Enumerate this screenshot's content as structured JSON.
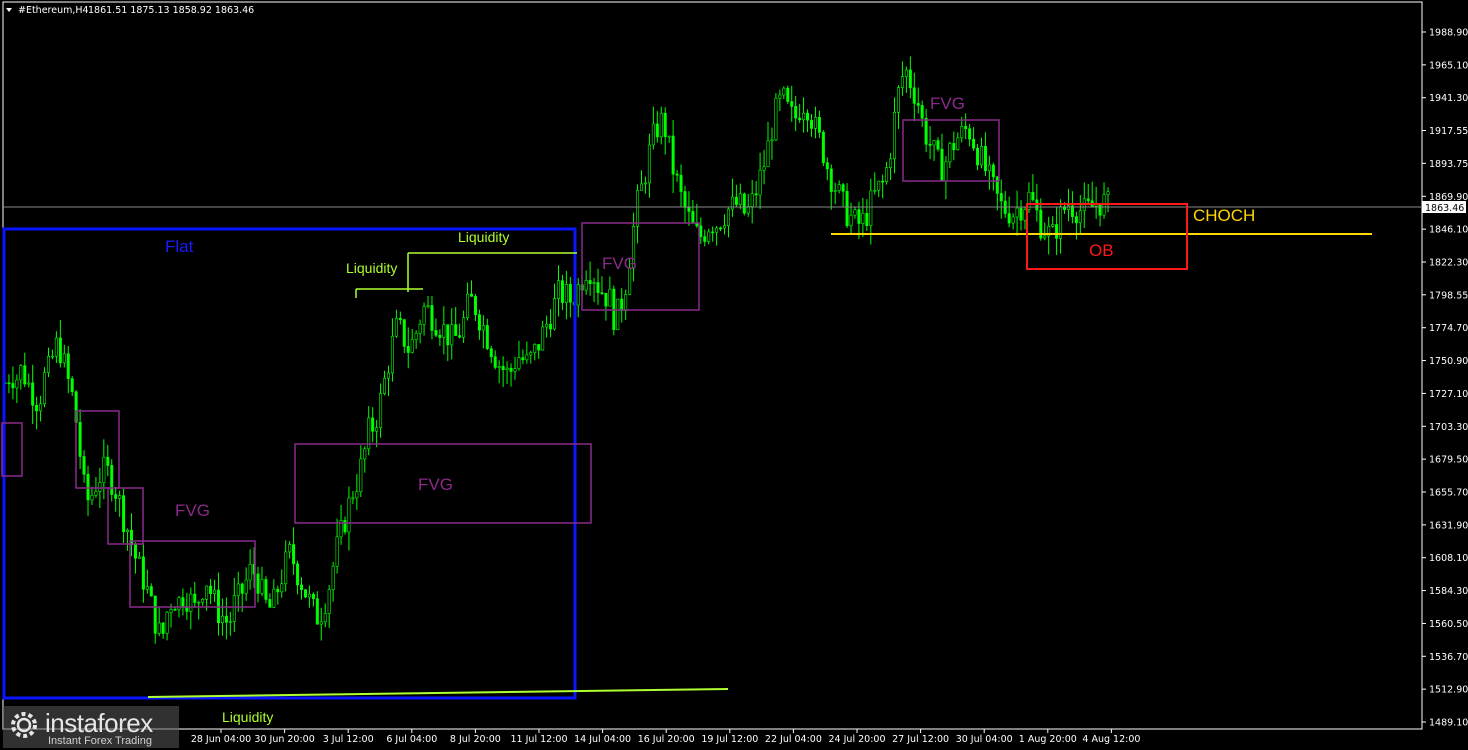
{
  "header": {
    "symbol": "#Ethereum,H4",
    "ohlc": "1861.51 1875.13 1858.92 1863.46"
  },
  "chart_data": {
    "type": "candlestick",
    "symbol": "#Ethereum",
    "timeframe": "H4",
    "current_price": "1863.46",
    "y_ticks": [
      "1988.90",
      "1965.10",
      "1941.30",
      "1917.55",
      "1893.75",
      "1869.90",
      "1846.10",
      "1822.30",
      "1798.55",
      "1774.70",
      "1750.90",
      "1727.10",
      "1703.30",
      "1679.50",
      "1655.70",
      "1631.90",
      "1608.10",
      "1584.30",
      "1560.50",
      "1536.70",
      "1512.90",
      "1489.10"
    ],
    "x_ticks": [
      "28 Jun 04:00",
      "30 Jun 20:00",
      "3 Jul 12:00",
      "6 Jul 04:00",
      "8 Jul 20:00",
      "11 Jul 12:00",
      "14 Jul 04:00",
      "16 Jul 20:00",
      "19 Jul 12:00",
      "22 Jul 04:00",
      "24 Jul 20:00",
      "27 Jul 12:00",
      "30 Jul 04:00",
      "1 Aug 20:00",
      "4 Aug 12:00"
    ],
    "ylim": [
      1483,
      2002
    ],
    "series": {
      "close_path": [
        1735,
        1742,
        1738,
        1745,
        1735,
        1728,
        1720,
        1738,
        1745,
        1762,
        1758,
        1740,
        1725,
        1700,
        1660,
        1648,
        1660,
        1668,
        1672,
        1665,
        1655,
        1640,
        1628,
        1612,
        1600,
        1590,
        1575,
        1560,
        1548,
        1570,
        1580,
        1576,
        1582,
        1578,
        1570,
        1585,
        1592,
        1580,
        1570,
        1565,
        1560,
        1575,
        1580,
        1590,
        1600,
        1595,
        1580,
        1570,
        1575,
        1590,
        1602,
        1612,
        1600,
        1590,
        1580,
        1570,
        1565,
        1575,
        1590,
        1610,
        1625,
        1640,
        1655,
        1665,
        1680,
        1700,
        1705,
        1720,
        1740,
        1760,
        1775,
        1770,
        1760,
        1765,
        1780,
        1790,
        1785,
        1780,
        1775,
        1770,
        1765,
        1770,
        1780,
        1795,
        1790,
        1780,
        1770,
        1760,
        1750,
        1745,
        1740,
        1750,
        1755,
        1748,
        1752,
        1760,
        1770,
        1780,
        1790,
        1800,
        1798,
        1795,
        1800,
        1810,
        1820,
        1815,
        1805,
        1800,
        1795,
        1780,
        1790,
        1810,
        1840,
        1865,
        1880,
        1900,
        1915,
        1925,
        1918,
        1895,
        1880,
        1865,
        1855,
        1845,
        1840,
        1845,
        1852,
        1850,
        1855,
        1860,
        1862,
        1865,
        1858,
        1860,
        1872,
        1885,
        1900,
        1920,
        1935,
        1940,
        1930,
        1925,
        1935,
        1940,
        1928,
        1915,
        1905,
        1890,
        1880,
        1870,
        1860,
        1855,
        1850,
        1850,
        1858,
        1868,
        1875,
        1880,
        1900,
        1930,
        1955,
        1960,
        1950,
        1940,
        1920,
        1910,
        1900,
        1890,
        1895,
        1905,
        1912,
        1915,
        1920,
        1910,
        1900,
        1890,
        1880,
        1870,
        1862,
        1860,
        1858,
        1862,
        1865,
        1870,
        1860,
        1850,
        1845,
        1840,
        1850,
        1860,
        1865,
        1862,
        1860,
        1858,
        1862,
        1865,
        1866,
        1863
      ]
    },
    "annotations": [
      {
        "label": "Flat",
        "kind": "range",
        "color": "#0a14ff"
      },
      {
        "label": "FVG",
        "kind": "zone",
        "color": "#8b2a8b",
        "index": 1
      },
      {
        "label": "FVG",
        "kind": "zone",
        "color": "#8b2a8b",
        "index": 2
      },
      {
        "label": "FVG",
        "kind": "zone",
        "color": "#8b2a8b",
        "index": 3
      },
      {
        "label": "FVG",
        "kind": "zone",
        "color": "#8b2a8b",
        "index": 4
      },
      {
        "label": "Liquidity",
        "kind": "level",
        "color": "#adff2f",
        "index": 1
      },
      {
        "label": "Liquidity",
        "kind": "level",
        "color": "#adff2f",
        "index": 2
      },
      {
        "label": "Liquidity",
        "kind": "level",
        "color": "#adff2f",
        "index": 3
      },
      {
        "label": "CHOCH",
        "kind": "level",
        "color": "#ffd700"
      },
      {
        "label": "OB",
        "kind": "zone",
        "color": "#ff1a1a"
      }
    ],
    "grid": false,
    "colors": {
      "background": "#000000",
      "candles": "#00ff00",
      "axis": "#ffffff"
    }
  },
  "labels": {
    "flat": "Flat",
    "fvg": "FVG",
    "liquidity": "Liquidity",
    "choch": "CHOCH",
    "ob": "OB",
    "price_tag": "1863.46"
  },
  "watermark": {
    "name": "instaforex",
    "tagline": "Instant Forex Trading"
  }
}
